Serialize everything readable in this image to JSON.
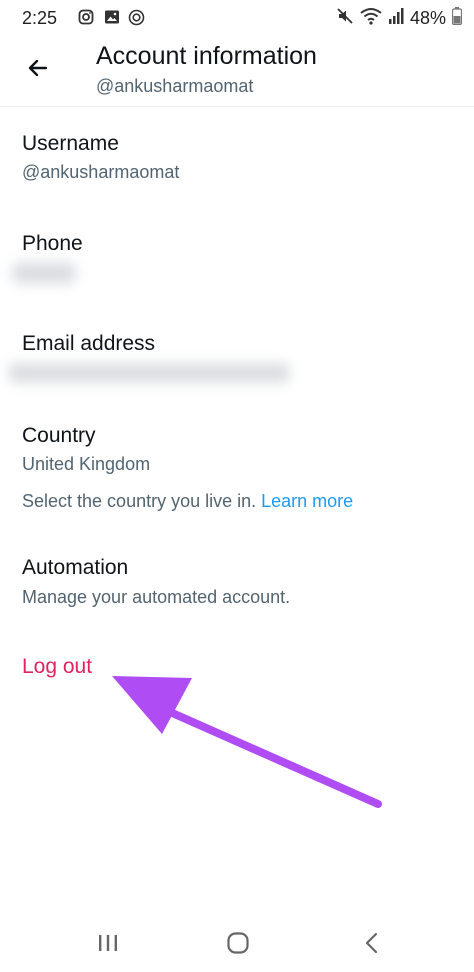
{
  "status_bar": {
    "time": "2:25",
    "battery": "48%",
    "icons": [
      "instagram-icon",
      "gallery-icon",
      "sync-icon",
      "mute-icon",
      "wifi-icon",
      "signal-icon",
      "battery-icon"
    ]
  },
  "header": {
    "title": "Account information",
    "subtitle": "@ankusharmaomat",
    "back_icon": "arrow-left-icon"
  },
  "items": {
    "username": {
      "label": "Username",
      "value": "@ankusharmaomat"
    },
    "phone": {
      "label": "Phone"
    },
    "email": {
      "label": "Email address"
    },
    "country": {
      "label": "Country",
      "value": "United Kingdom",
      "help": "Select the country you live in.",
      "learn_more": "Learn more"
    },
    "automation": {
      "label": "Automation",
      "value": "Manage your automated account."
    }
  },
  "logout": {
    "label": "Log out"
  },
  "colors": {
    "primary_text": "#0f1419",
    "secondary_text": "#536471",
    "link": "#1d9bf0",
    "logout": "#e0245e",
    "annotation_arrow": "#b04cf4"
  },
  "nav_bar": {
    "icons": [
      "recent-apps-icon",
      "home-icon",
      "back-icon"
    ]
  }
}
